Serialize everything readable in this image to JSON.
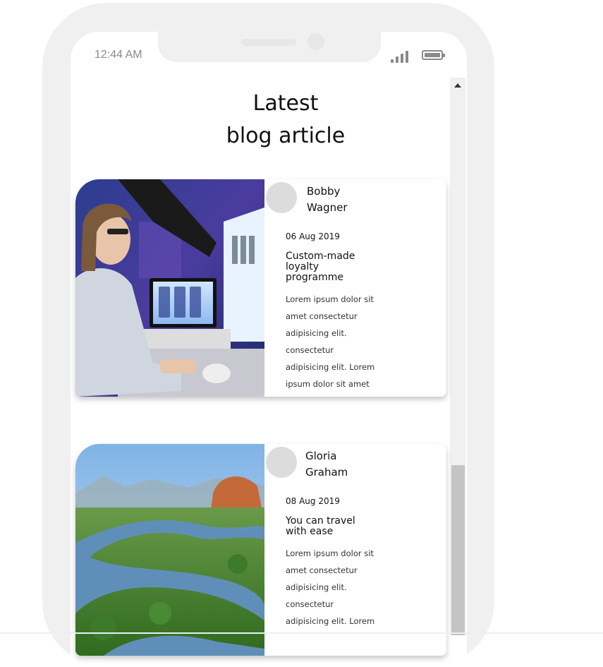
{
  "status_bar": {
    "time": "12:44 AM"
  },
  "page": {
    "heading_line1": "Latest",
    "heading_line2": "blog article"
  },
  "articles": [
    {
      "author_first": "Bobby",
      "author_last": "Wagner",
      "date": "06 Aug 2019",
      "title_lines": [
        "Custom-made",
        "loyalty",
        "programme"
      ],
      "excerpt_lines": [
        "Lorem ipsum dolor sit",
        "amet consectetur",
        "adipisicing elit.",
        "consectetur",
        "adipisicing elit. Lorem",
        "ipsum dolor sit amet"
      ],
      "image": "person-at-computer-photo"
    },
    {
      "author_first": "Gloria",
      "author_last": "Graham",
      "date": "08 Aug 2019",
      "title_lines": [
        "You can travel",
        "with ease"
      ],
      "excerpt_lines": [
        "Lorem ipsum dolor sit",
        "amet consectetur",
        "adipisicing elit.",
        "consectetur",
        "adipisicing elit. Lorem"
      ],
      "image": "river-landscape-photo"
    }
  ],
  "icons": {
    "signal": "signal-icon",
    "battery": "battery-icon",
    "scroll_up": "arrow-up-icon"
  }
}
